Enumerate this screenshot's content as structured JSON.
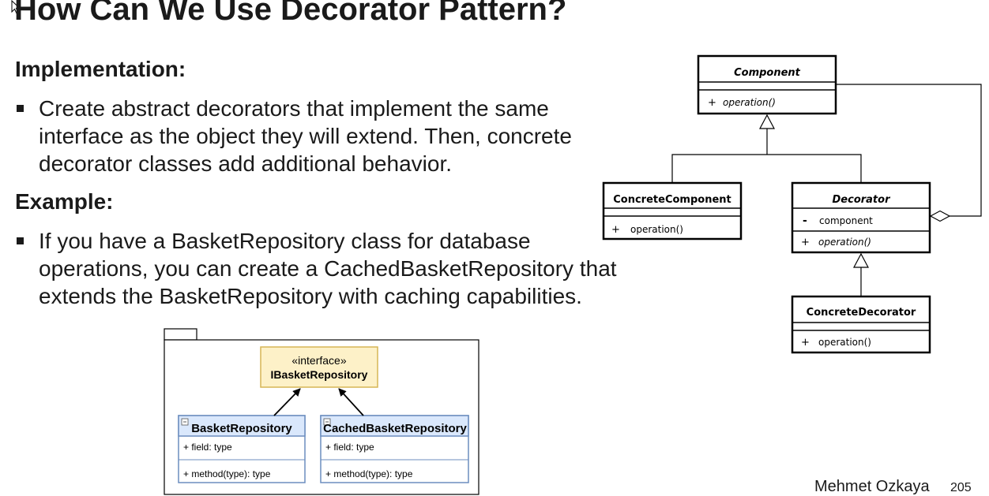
{
  "slide": {
    "title": "How Can We Use Decorator Pattern?",
    "implementation_heading": "Implementation:",
    "implementation_lines": [
      "Create abstract decorators that implement the same",
      "interface as the object they will extend. Then, concrete",
      "decorator classes add additional behavior."
    ],
    "example_heading": "Example:",
    "example_lines": [
      "If you have a BasketRepository class for database",
      "operations, you can create a CachedBasketRepository that",
      "extends the BasketRepository with caching capabilities."
    ],
    "author": "Mehmet Ozkaya",
    "page_number": "205"
  },
  "uml_decorator": {
    "component": {
      "name": "Component",
      "op_vis": "+",
      "op": "operation()"
    },
    "concrete_component": {
      "name": "ConcreteComponent",
      "op_vis": "+",
      "op": "operation()"
    },
    "decorator": {
      "name": "Decorator",
      "attr_vis": "-",
      "attr": "component",
      "op_vis": "+",
      "op": "operation()"
    },
    "concrete_decorator": {
      "name": "ConcreteDecorator",
      "op_vis": "+",
      "op": "operation()"
    }
  },
  "uml_basket": {
    "interface_stereotype": "«interface»",
    "interface_name": "IBasketRepository",
    "basket": {
      "name": "BasketRepository",
      "field": "+ field: type",
      "method": "+ method(type): type"
    },
    "cached": {
      "name": "CachedBasketRepository",
      "field": "+ field: type",
      "method": "+ method(type): type"
    }
  },
  "colors": {
    "interface_fill": "#fdf1c8",
    "interface_border": "#d6b656",
    "class_header_fill": "#dae8fc",
    "class_border": "#6c8ebf"
  }
}
